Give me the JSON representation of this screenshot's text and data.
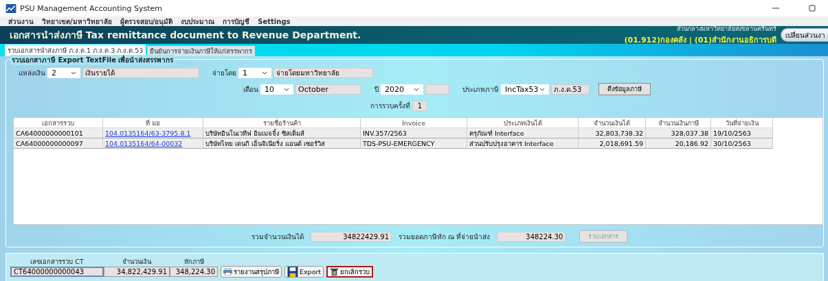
{
  "window": {
    "title": "PSU Management Accounting System"
  },
  "menu": [
    "ส่วนงาน",
    "วิทยาเขต/มหาวิทยาลัย",
    "ผู้ตรวจสอบ/อนุมัติ",
    "งบประมาณ",
    "การบัญชี",
    "Settings"
  ],
  "header": {
    "title": "เอกสารนำส่งภาษี Tax remittance document to Revenue Department.",
    "org": "ส่วนกลางมหาวิทยาลัยสงขลานครินทร์",
    "unit": "(01.912)กองคลัง | (01)สำนักงานอธิการบดี",
    "button": "เปลี่ยนส่วนงา"
  },
  "tabs": [
    {
      "label": "รวบเอกสารนำส่งภาษี ภ.ง.ด.1 ภ.ง.ด.3 ภ.ง.ด.53",
      "selected": true
    },
    {
      "label": "ยืนยันการจ่ายเงินภาษีให้แก่สรรพากร",
      "selected": false
    }
  ],
  "group": {
    "title": "รวบเอกสาภาษี Export TextFile เพื่อนำส่งสรรพากร",
    "source": {
      "label": "แหล่งเงิน",
      "code": "2",
      "name": "เงินรายได้"
    },
    "paid_by": {
      "label": "จ่ายโดย",
      "code": "1",
      "name": "จ่ายโดยมหาวิทยาลัย"
    },
    "month": {
      "label": "เดือน",
      "code": "10",
      "name": "October"
    },
    "year": {
      "label": "ปี",
      "code": "2020"
    },
    "tax_type": {
      "label": "ประเภทภาษี",
      "code": "IncTax53",
      "name": "ภ.ง.ด.53"
    },
    "fetch_button": "ดึงข้อมูลภาษี",
    "batch": {
      "label": "การรวบครั้งที่",
      "value": "1"
    }
  },
  "table": {
    "columns": [
      "เอกสารรวบ",
      "ที่ มอ",
      "รายชื่อร้านค้า",
      "Invoice",
      "ประเภทเงินได้",
      "จำนวนเงินได้",
      "จำนวนเงินภาษี",
      "วันที่จ่ายเงิน"
    ],
    "rows": [
      {
        "cells": [
          "CA64000000000101",
          "104.0135164/63-3795.8.1",
          "บริษัทอินโนเวทีฟ อิมเมจจิ้ง ซิสเต็มส์",
          "INV.357/2563",
          "ครุภัณฑ์ Interface",
          "32,803,738.32",
          "328,037.38",
          "19/10/2563"
        ]
      },
      {
        "cells": [
          "CA64000000000097",
          "104.0135164/64-00032",
          "บริษัทไทย เดนกิ เอ็นจิเนียริ่ง แอนด์ เซอร์วิส",
          "TDS-PSU-EMERGENCY",
          "ส่วนปรับปรุงอาคาร Interface",
          "2,018,691.59",
          "20,186.92",
          "30/10/2563"
        ]
      }
    ]
  },
  "totals": {
    "income_label": "รวมจำนวนเงินได้",
    "income": "34822429.91",
    "tax_label": "รวมยอดภาษีหัก ณ ที่จ่ายนำส่ง",
    "tax": "348224.30",
    "button": {
      "label": "รวบเอกสาร",
      "disabled": true
    }
  },
  "ct": {
    "columns": [
      "เลขเอกสารรวบ CT",
      "จำนวนเงิน",
      "หักภาษี"
    ],
    "row": [
      "CT64000000000043",
      "34,822,429.91",
      "348,224.30"
    ],
    "buttons": [
      {
        "label": "รายงานสรุปภาษี",
        "kind": "print",
        "focused": false
      },
      {
        "label": "Export",
        "kind": "save",
        "focused": false
      },
      {
        "label": "ยกเลิกรวบ",
        "kind": "delete",
        "focused": true
      }
    ]
  }
}
